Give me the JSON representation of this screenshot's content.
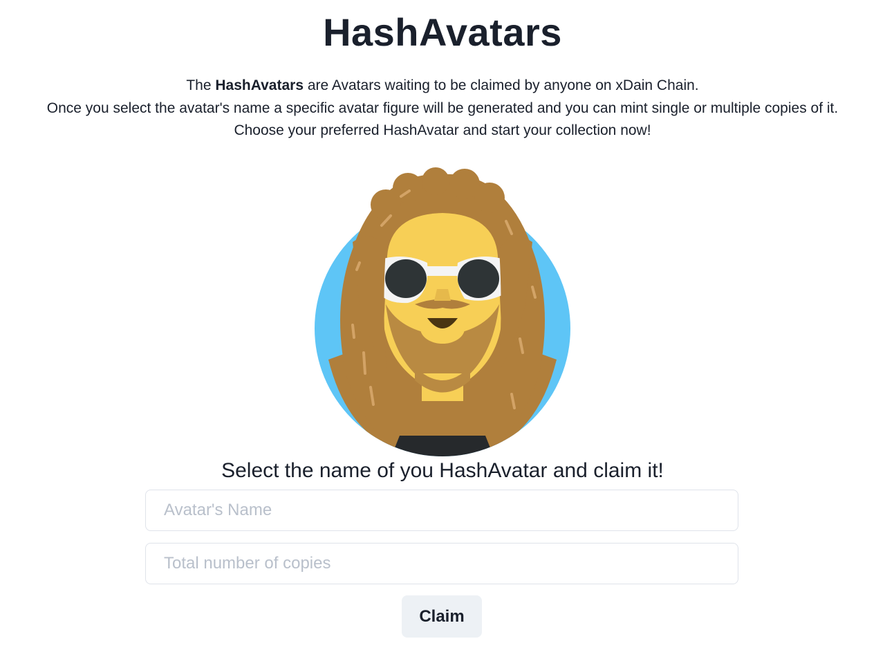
{
  "header": {
    "title": "HashAvatars"
  },
  "intro": {
    "line1_prefix": "The ",
    "line1_bold": "HashAvatars",
    "line1_suffix": " are Avatars waiting to be claimed by anyone on xDain Chain.",
    "line2": "Once you select the avatar's name a specific avatar figure will be generated and you can mint single or multiple copies of it.",
    "line3": "Choose your preferred HashAvatar and start your collection now!"
  },
  "avatar": {
    "icon": "avatar-illustration",
    "colors": {
      "background": "#5ec5f6",
      "hair": "#b07f3c",
      "skin": "#f7cf56",
      "glasses_frame": "#f4f4f4",
      "lenses": "#2e3436",
      "shirt": "#26292c"
    }
  },
  "claim_form": {
    "prompt": "Select the name of you HashAvatar and claim it!",
    "name_placeholder": "Avatar's Name",
    "name_value": "",
    "copies_placeholder": "Total number of copies",
    "copies_value": "",
    "claim_label": "Claim"
  }
}
